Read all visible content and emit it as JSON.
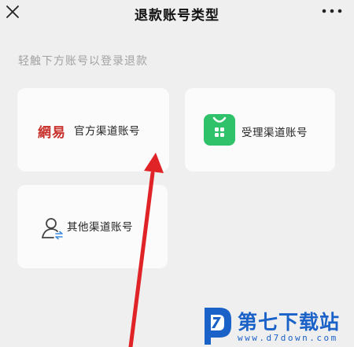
{
  "header": {
    "title": "退款账号类型",
    "close_icon": "close-icon",
    "more_icon": "more-icon"
  },
  "hint": "轻触下方账号以登录退款",
  "cards": [
    {
      "label": "官方渠道账号",
      "logo_text": "網易",
      "icon": "netease-logo"
    },
    {
      "label": "受理渠道账号",
      "icon": "green-app-icon"
    },
    {
      "label": "其他渠道账号",
      "icon": "person-switch-icon"
    }
  ],
  "watermark": {
    "title": "第七下载站",
    "url": "www.d7down.com"
  },
  "colors": {
    "background": "#efefef",
    "card": "#fbfbfb",
    "netease_red": "#c8312c",
    "green_icon": "#2fc26b",
    "arrow_red": "#e02326",
    "watermark_blue": "#1a61c8"
  }
}
